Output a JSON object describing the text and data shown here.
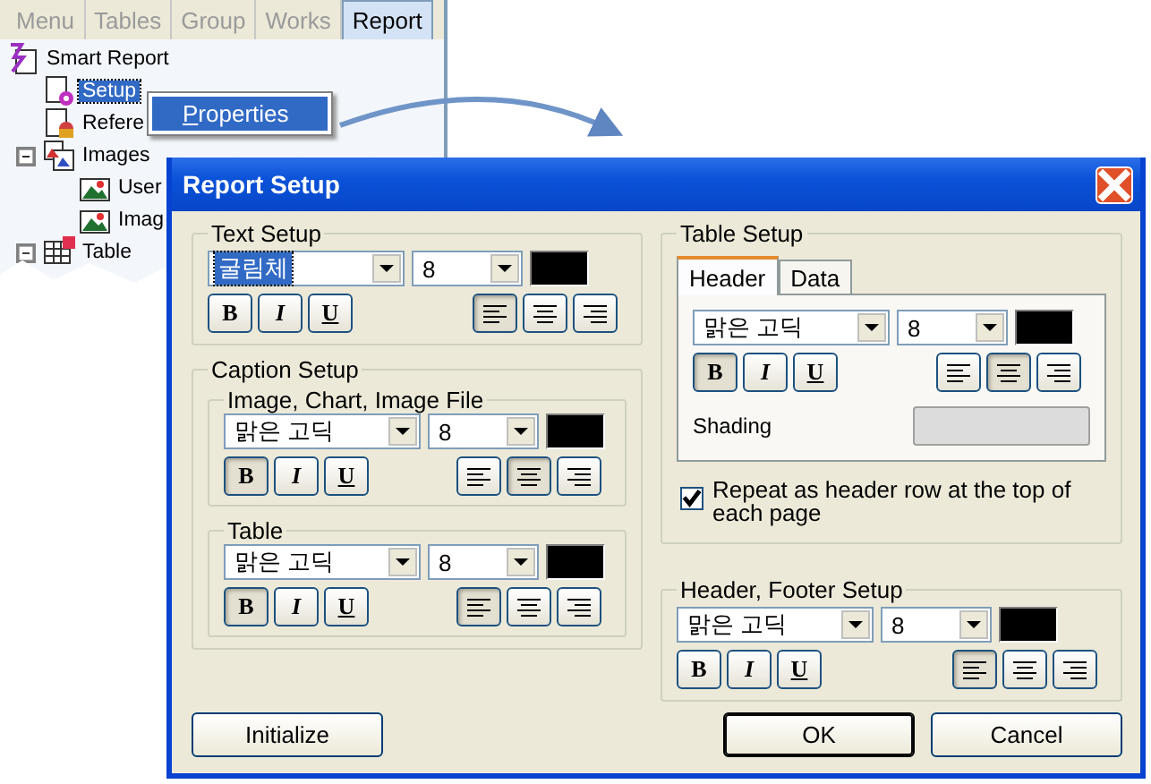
{
  "tree_panel": {
    "tabs": [
      {
        "label": "Menu",
        "selected": false
      },
      {
        "label": "Tables",
        "selected": false
      },
      {
        "label": "Group",
        "selected": false
      },
      {
        "label": "Works",
        "selected": false
      },
      {
        "label": "Report",
        "selected": true
      }
    ],
    "tree": [
      {
        "label": "Smart Report",
        "kind": "report",
        "selected": false,
        "children": [
          {
            "label": "Setup",
            "kind": "setup",
            "selected": true
          },
          {
            "label": "Refere",
            "kind": "database",
            "selected": false
          },
          {
            "label": "Images",
            "kind": "images",
            "selected": false,
            "expanded": true,
            "children": [
              {
                "label": "User",
                "kind": "image",
                "selected": false
              },
              {
                "label": "Imag",
                "kind": "image",
                "selected": false
              }
            ]
          },
          {
            "label": "Table",
            "kind": "table",
            "selected": false,
            "expanded": true
          }
        ]
      }
    ]
  },
  "context_menu": {
    "items": [
      {
        "label": "Properties",
        "selected": true
      }
    ]
  },
  "dialog": {
    "title": "Report Setup",
    "text_setup": {
      "title": "Text Setup",
      "font": {
        "face": "굴림체",
        "size": "8",
        "color": "#000000",
        "highlighted": true,
        "styles": [
          {
            "kind": "bold",
            "label": "B",
            "pressed": false
          },
          {
            "kind": "italic",
            "label": "I",
            "pressed": false
          },
          {
            "kind": "underline",
            "label": "U",
            "pressed": false
          }
        ],
        "alignments": [
          {
            "kind": "left",
            "selected": true
          },
          {
            "kind": "center",
            "selected": false
          },
          {
            "kind": "right",
            "selected": false
          }
        ]
      }
    },
    "caption_setup": {
      "title": "Caption Setup",
      "groups": [
        {
          "title": "Image, Chart, Image File",
          "font": {
            "face": "맑은 고딕",
            "size": "8",
            "color": "#000000",
            "highlighted": false,
            "styles": [
              {
                "kind": "bold",
                "label": "B",
                "pressed": true
              },
              {
                "kind": "italic",
                "label": "I",
                "pressed": false
              },
              {
                "kind": "underline",
                "label": "U",
                "pressed": false
              }
            ],
            "alignments": [
              {
                "kind": "left",
                "selected": false
              },
              {
                "kind": "center",
                "selected": true
              },
              {
                "kind": "right",
                "selected": false
              }
            ]
          }
        },
        {
          "title": "Table",
          "font": {
            "face": "맑은 고딕",
            "size": "8",
            "color": "#000000",
            "highlighted": false,
            "styles": [
              {
                "kind": "bold",
                "label": "B",
                "pressed": true
              },
              {
                "kind": "italic",
                "label": "I",
                "pressed": false
              },
              {
                "kind": "underline",
                "label": "U",
                "pressed": false
              }
            ],
            "alignments": [
              {
                "kind": "left",
                "selected": true
              },
              {
                "kind": "center",
                "selected": false
              },
              {
                "kind": "right",
                "selected": false
              }
            ]
          }
        }
      ]
    },
    "table_setup": {
      "title": "Table Setup",
      "tabs": [
        {
          "label": "Header",
          "selected": true
        },
        {
          "label": "Data",
          "selected": false
        }
      ],
      "font": {
        "face": "맑은 고딕",
        "size": "8",
        "color": "#000000",
        "highlighted": false,
        "styles": [
          {
            "kind": "bold",
            "label": "B",
            "pressed": true
          },
          {
            "kind": "italic",
            "label": "I",
            "pressed": false
          },
          {
            "kind": "underline",
            "label": "U",
            "pressed": false
          }
        ],
        "alignments": [
          {
            "kind": "left",
            "selected": false
          },
          {
            "kind": "center",
            "selected": true
          },
          {
            "kind": "right",
            "selected": false
          }
        ]
      },
      "shading": {
        "label": "Shading",
        "color": "#dcdcdc"
      },
      "repeat_header": {
        "label": "Repeat as header row at the top of each page",
        "checked": true
      }
    },
    "header_footer_setup": {
      "title": "Header, Footer Setup",
      "font": {
        "face": "맑은 고딕",
        "size": "8",
        "color": "#000000",
        "highlighted": false,
        "styles": [
          {
            "kind": "bold",
            "label": "B",
            "pressed": false
          },
          {
            "kind": "italic",
            "label": "I",
            "pressed": false
          },
          {
            "kind": "underline",
            "label": "U",
            "pressed": false
          }
        ],
        "alignments": [
          {
            "kind": "left",
            "selected": true
          },
          {
            "kind": "center",
            "selected": false
          },
          {
            "kind": "right",
            "selected": false
          }
        ]
      }
    },
    "buttons": [
      {
        "label": "Initialize",
        "default": false
      },
      {
        "label": "OK",
        "default": true
      },
      {
        "label": "Cancel",
        "default": false
      }
    ]
  }
}
